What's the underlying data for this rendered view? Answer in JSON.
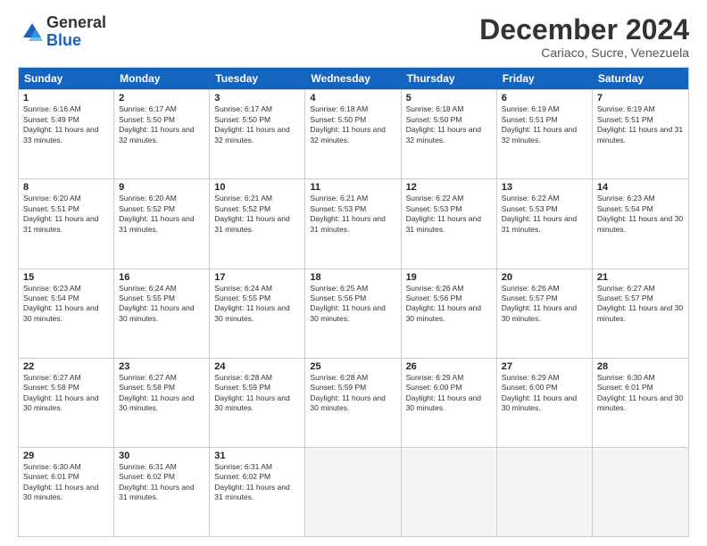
{
  "header": {
    "logo_general": "General",
    "logo_blue": "Blue",
    "main_title": "December 2024",
    "subtitle": "Cariaco, Sucre, Venezuela"
  },
  "calendar": {
    "days_of_week": [
      "Sunday",
      "Monday",
      "Tuesday",
      "Wednesday",
      "Thursday",
      "Friday",
      "Saturday"
    ],
    "weeks": [
      [
        {
          "num": "1",
          "rise": "6:16 AM",
          "set": "5:49 PM",
          "daylight": "11 hours and 33 minutes."
        },
        {
          "num": "2",
          "rise": "6:17 AM",
          "set": "5:50 PM",
          "daylight": "11 hours and 32 minutes."
        },
        {
          "num": "3",
          "rise": "6:17 AM",
          "set": "5:50 PM",
          "daylight": "11 hours and 32 minutes."
        },
        {
          "num": "4",
          "rise": "6:18 AM",
          "set": "5:50 PM",
          "daylight": "11 hours and 32 minutes."
        },
        {
          "num": "5",
          "rise": "6:18 AM",
          "set": "5:50 PM",
          "daylight": "11 hours and 32 minutes."
        },
        {
          "num": "6",
          "rise": "6:19 AM",
          "set": "5:51 PM",
          "daylight": "11 hours and 32 minutes."
        },
        {
          "num": "7",
          "rise": "6:19 AM",
          "set": "5:51 PM",
          "daylight": "11 hours and 31 minutes."
        }
      ],
      [
        {
          "num": "8",
          "rise": "6:20 AM",
          "set": "5:51 PM",
          "daylight": "11 hours and 31 minutes."
        },
        {
          "num": "9",
          "rise": "6:20 AM",
          "set": "5:52 PM",
          "daylight": "11 hours and 31 minutes."
        },
        {
          "num": "10",
          "rise": "6:21 AM",
          "set": "5:52 PM",
          "daylight": "11 hours and 31 minutes."
        },
        {
          "num": "11",
          "rise": "6:21 AM",
          "set": "5:53 PM",
          "daylight": "11 hours and 31 minutes."
        },
        {
          "num": "12",
          "rise": "6:22 AM",
          "set": "5:53 PM",
          "daylight": "11 hours and 31 minutes."
        },
        {
          "num": "13",
          "rise": "6:22 AM",
          "set": "5:53 PM",
          "daylight": "11 hours and 31 minutes."
        },
        {
          "num": "14",
          "rise": "6:23 AM",
          "set": "5:54 PM",
          "daylight": "11 hours and 30 minutes."
        }
      ],
      [
        {
          "num": "15",
          "rise": "6:23 AM",
          "set": "5:54 PM",
          "daylight": "11 hours and 30 minutes."
        },
        {
          "num": "16",
          "rise": "6:24 AM",
          "set": "5:55 PM",
          "daylight": "11 hours and 30 minutes."
        },
        {
          "num": "17",
          "rise": "6:24 AM",
          "set": "5:55 PM",
          "daylight": "11 hours and 30 minutes."
        },
        {
          "num": "18",
          "rise": "6:25 AM",
          "set": "5:56 PM",
          "daylight": "11 hours and 30 minutes."
        },
        {
          "num": "19",
          "rise": "6:26 AM",
          "set": "5:56 PM",
          "daylight": "11 hours and 30 minutes."
        },
        {
          "num": "20",
          "rise": "6:26 AM",
          "set": "5:57 PM",
          "daylight": "11 hours and 30 minutes."
        },
        {
          "num": "21",
          "rise": "6:27 AM",
          "set": "5:57 PM",
          "daylight": "11 hours and 30 minutes."
        }
      ],
      [
        {
          "num": "22",
          "rise": "6:27 AM",
          "set": "5:58 PM",
          "daylight": "11 hours and 30 minutes."
        },
        {
          "num": "23",
          "rise": "6:27 AM",
          "set": "5:58 PM",
          "daylight": "11 hours and 30 minutes."
        },
        {
          "num": "24",
          "rise": "6:28 AM",
          "set": "5:59 PM",
          "daylight": "11 hours and 30 minutes."
        },
        {
          "num": "25",
          "rise": "6:28 AM",
          "set": "5:59 PM",
          "daylight": "11 hours and 30 minutes."
        },
        {
          "num": "26",
          "rise": "6:29 AM",
          "set": "6:00 PM",
          "daylight": "11 hours and 30 minutes."
        },
        {
          "num": "27",
          "rise": "6:29 AM",
          "set": "6:00 PM",
          "daylight": "11 hours and 30 minutes."
        },
        {
          "num": "28",
          "rise": "6:30 AM",
          "set": "6:01 PM",
          "daylight": "11 hours and 30 minutes."
        }
      ],
      [
        {
          "num": "29",
          "rise": "6:30 AM",
          "set": "6:01 PM",
          "daylight": "11 hours and 30 minutes."
        },
        {
          "num": "30",
          "rise": "6:31 AM",
          "set": "6:02 PM",
          "daylight": "11 hours and 31 minutes."
        },
        {
          "num": "31",
          "rise": "6:31 AM",
          "set": "6:02 PM",
          "daylight": "11 hours and 31 minutes."
        },
        null,
        null,
        null,
        null
      ]
    ]
  }
}
